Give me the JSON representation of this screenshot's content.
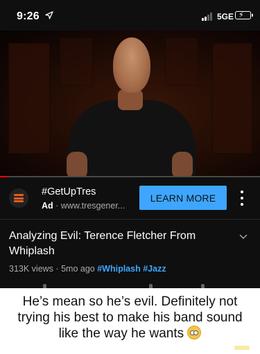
{
  "status_bar": {
    "time": "9:26",
    "location_icon": "location-arrow-icon",
    "network": "5GE",
    "battery_state": "charging",
    "signal_level": 0.5
  },
  "video": {
    "description_icon": "video-thumbnail",
    "progress": 0.03,
    "progress_color": "#ff0000"
  },
  "ad": {
    "title": "#GetUpTres",
    "badge": "Ad",
    "separator": "·",
    "url": "www.tresgener...",
    "cta_label": "LEARN MORE",
    "cta_color": "#3ea6ff",
    "more_icon": "kebab-menu-icon"
  },
  "details": {
    "title": "Analyzing Evil: Terence Fletcher From Whiplash",
    "views": "313K views",
    "dot": "·",
    "age": "5mo ago",
    "tags": [
      "#Whiplash",
      "#Jazz"
    ],
    "expand_icon": "chevron-down-icon"
  },
  "caption": {
    "text": "He’s mean so he’s evil. Definitely not trying his best to make his band sound like the way he wants",
    "emoji": "flushed-face-emoji"
  }
}
